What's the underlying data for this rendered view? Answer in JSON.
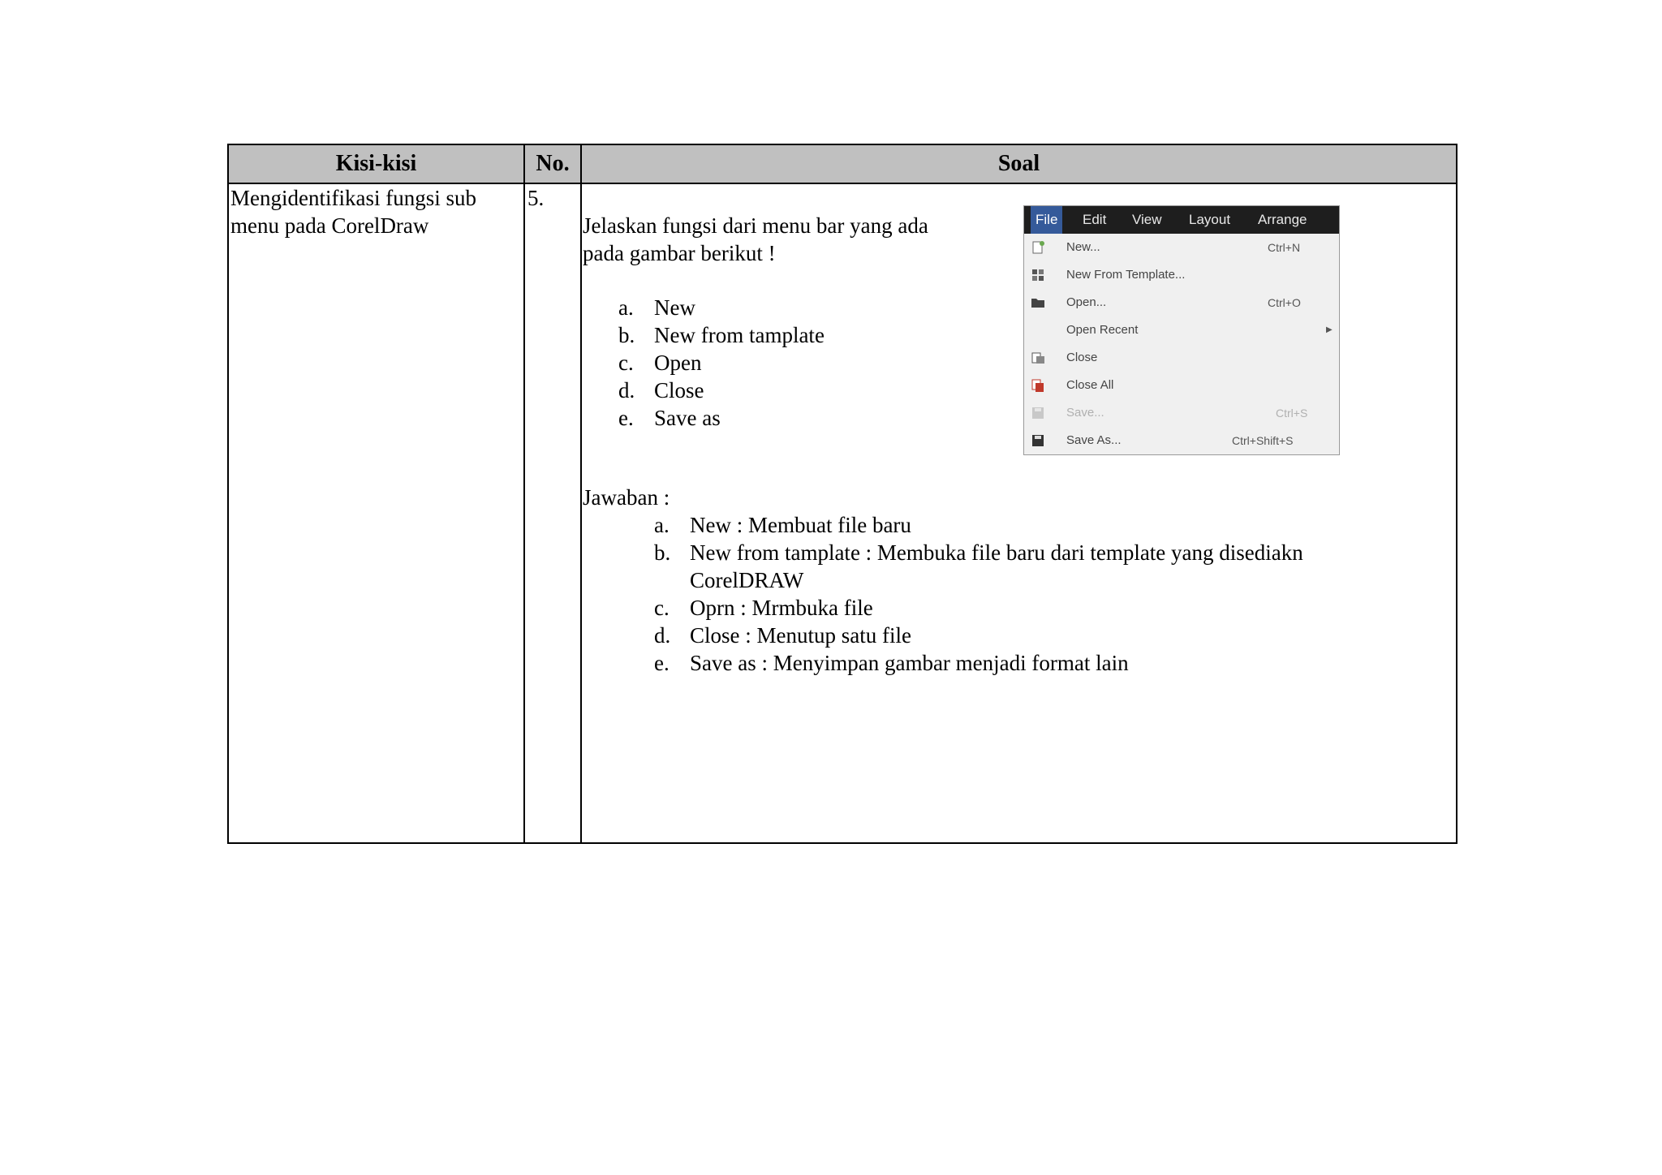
{
  "table": {
    "headers": {
      "col1": "Kisi-kisi",
      "col2": "No.",
      "col3": "Soal"
    },
    "row": {
      "kisi_line1": "Mengidentifikasi  fungsi  sub",
      "kisi_line2": "menu  pada CorelDraw",
      "number": "5.",
      "question_line1": "Jelaskan  fungsi  dari menu  bar yang  ada",
      "question_line2": "pada gambar  berikut  !",
      "options": [
        {
          "marker": "a.",
          "text": "New"
        },
        {
          "marker": "b.",
          "text": "New from  tamplate"
        },
        {
          "marker": "c.",
          "text": "Open"
        },
        {
          "marker": "d.",
          "text": "Close"
        },
        {
          "marker": "e.",
          "text": "Save as"
        }
      ],
      "answer_label": "Jawaban :",
      "answers": [
        {
          "marker": "a.",
          "text": "New : Membuat  file  baru"
        },
        {
          "marker": "b.",
          "text": "New from  tamplate  : Membuka  file  baru dari template  yang  disediakn CorelDRAW"
        },
        {
          "marker": "c.",
          "text": "Oprn : Mrmbuka  file"
        },
        {
          "marker": "d.",
          "text": "Close : Menutup  satu file"
        },
        {
          "marker": "e.",
          "text": "Save as : Menyimpan  gambar  menjadi  format  lain"
        }
      ]
    }
  },
  "menu_screenshot": {
    "menubar": [
      "File",
      "Edit",
      "View",
      "Layout",
      "Arrange"
    ],
    "items": [
      {
        "label": "New...",
        "shortcut": "Ctrl+N",
        "icon": "new-document-icon"
      },
      {
        "label": "New From Template...",
        "shortcut": "",
        "icon": "template-icon"
      },
      {
        "label": "Open...",
        "shortcut": "Ctrl+O",
        "icon": "folder-open-icon"
      },
      {
        "label": "Open Recent",
        "shortcut": "",
        "icon": ""
      },
      {
        "label": "Close",
        "shortcut": "",
        "icon": "close-document-icon"
      },
      {
        "label": "Close All",
        "shortcut": "",
        "icon": "close-all-icon"
      },
      {
        "label": "Save...",
        "shortcut": "Ctrl+S",
        "icon": "save-icon"
      },
      {
        "label": "Save As...",
        "shortcut": "Ctrl+Shift+S",
        "icon": "save-as-icon"
      }
    ],
    "colors": {
      "menubar_bg": "#1e1e1e",
      "selected_bg": "#355a9a",
      "menu_bg": "#f0f0f0"
    }
  }
}
